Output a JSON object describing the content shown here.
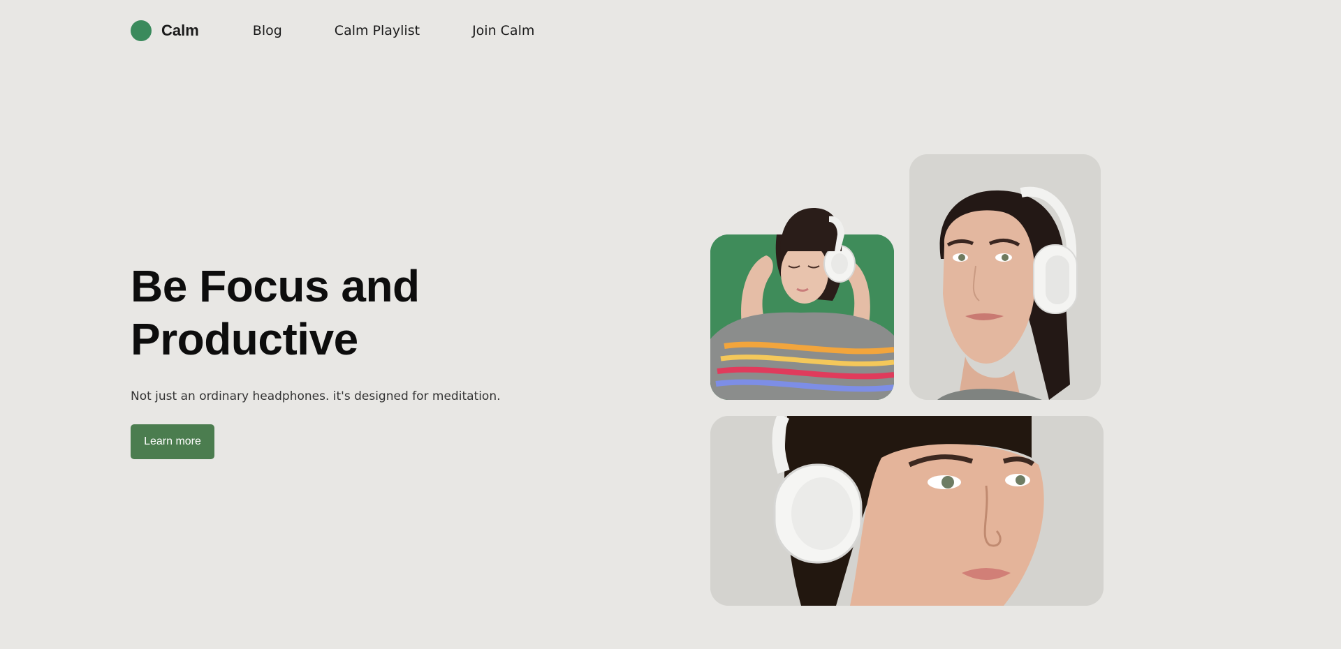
{
  "brand": {
    "name": "Calm",
    "logo_color": "#3a8a5c"
  },
  "nav": {
    "items": [
      {
        "label": "Blog"
      },
      {
        "label": "Calm Playlist"
      },
      {
        "label": "Join Calm"
      }
    ]
  },
  "hero": {
    "title_line1": "Be Focus and",
    "title_line2": "Productive",
    "subtitle": "Not just an ordinary headphones. it's designed for meditation.",
    "cta_label": "Learn more",
    "cta_color": "#4b7d4f"
  },
  "gallery": {
    "images": [
      {
        "description_icon": "woman-with-headphones-photo",
        "background": "#3f8c5a"
      },
      {
        "description_icon": "woman-portrait-headphones-photo",
        "background": "#d6d5d1"
      },
      {
        "description_icon": "woman-closeup-headphones-photo",
        "background": "#d4d3cf"
      }
    ]
  },
  "colors": {
    "background": "#e8e7e4",
    "accent": "#3a8a5c"
  }
}
